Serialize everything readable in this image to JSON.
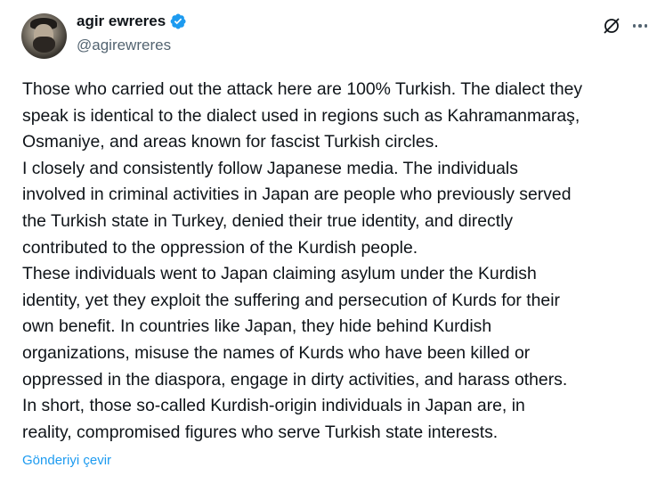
{
  "author": {
    "name": "agir ewreres",
    "handle": "@agirewreres",
    "verified": true,
    "verified_color": "#1d9bf0"
  },
  "icons": {
    "grok": "grok-slash-circle-icon",
    "more": "more-horizontal-icon"
  },
  "tweet": {
    "text": "Those who carried out the attack here are 100% Turkish. The dialect they\nspeak is identical to the dialect used in regions such as Kahramanmaraş,\nOsmaniye, and areas known for fascist Turkish circles.\nI closely and consistently follow Japanese media. The individuals\ninvolved in criminal activities in Japan are people who previously served\nthe Turkish state in Turkey, denied their true identity, and directly\ncontributed to the oppression of the Kurdish people.\nThese individuals went to Japan claiming asylum under the Kurdish\nidentity, yet they exploit the suffering and persecution of Kurds for their\nown benefit. In countries like Japan, they hide behind Kurdish\norganizations, misuse the names of Kurds who have been killed or\noppressed in the diaspora, engage in dirty activities, and harass others.\nIn short, those so-called Kurdish-origin individuals in Japan are, in\nreality, compromised figures who serve Turkish state interests.",
    "translate_label": "Gönderiyi çevir"
  },
  "colors": {
    "text": "#0f1419",
    "secondary": "#536471",
    "link": "#1d9bf0"
  }
}
